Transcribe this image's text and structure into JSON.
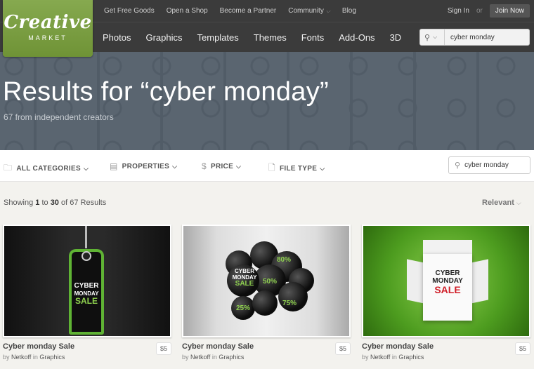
{
  "logo": {
    "line1": "Creative",
    "line2": "MARKET"
  },
  "topbar": {
    "links": [
      "Get Free Goods",
      "Open a Shop",
      "Become a Partner",
      "Community",
      "Blog"
    ],
    "signin": "Sign In",
    "or": "or",
    "join": "Join Now"
  },
  "nav": {
    "items": [
      "Photos",
      "Graphics",
      "Templates",
      "Themes",
      "Fonts",
      "Add-Ons",
      "3D"
    ],
    "search_value": "cyber monday"
  },
  "hero": {
    "title": "Results for “cyber monday”",
    "subtitle": "67 from independent creators"
  },
  "filters": {
    "categories": "ALL CATEGORIES",
    "properties": "PROPERTIES",
    "price": "PRICE",
    "file_type": "FILE TYPE",
    "search_value": "cyber monday"
  },
  "results": {
    "showing_prefix": "Showing ",
    "range_start": "1",
    "to": " to ",
    "range_end": "30",
    "of": " of 67 Results",
    "sort": "Relevant"
  },
  "cards": [
    {
      "title": "Cyber monday Sale",
      "by": "by ",
      "author": "Netkoff",
      "in": " in ",
      "category": "Graphics",
      "price": "$5",
      "art": {
        "l1": "CYBER",
        "l2": "MONDAY",
        "l3": "SALE"
      }
    },
    {
      "title": "Cyber monday Sale",
      "by": "by ",
      "author": "Netkoff",
      "in": " in ",
      "category": "Graphics",
      "price": "$5",
      "art": {
        "l1": "CYBER",
        "l2": "MONDAY",
        "l3": "SALE",
        "p80": "80%",
        "p50": "50%",
        "p25": "25%",
        "p75": "75%"
      }
    },
    {
      "title": "Cyber monday Sale",
      "by": "by ",
      "author": "Netkoff",
      "in": " in ",
      "category": "Graphics",
      "price": "$5",
      "art": {
        "l1": "CYBER",
        "l2": "MONDAY",
        "l3": "SALE"
      }
    }
  ],
  "colors": {
    "logo_green": "#7a9d3e",
    "header_bg": "#3b3b3b",
    "hero_bg": "#5a6570",
    "accent_green": "#8fd14f"
  }
}
